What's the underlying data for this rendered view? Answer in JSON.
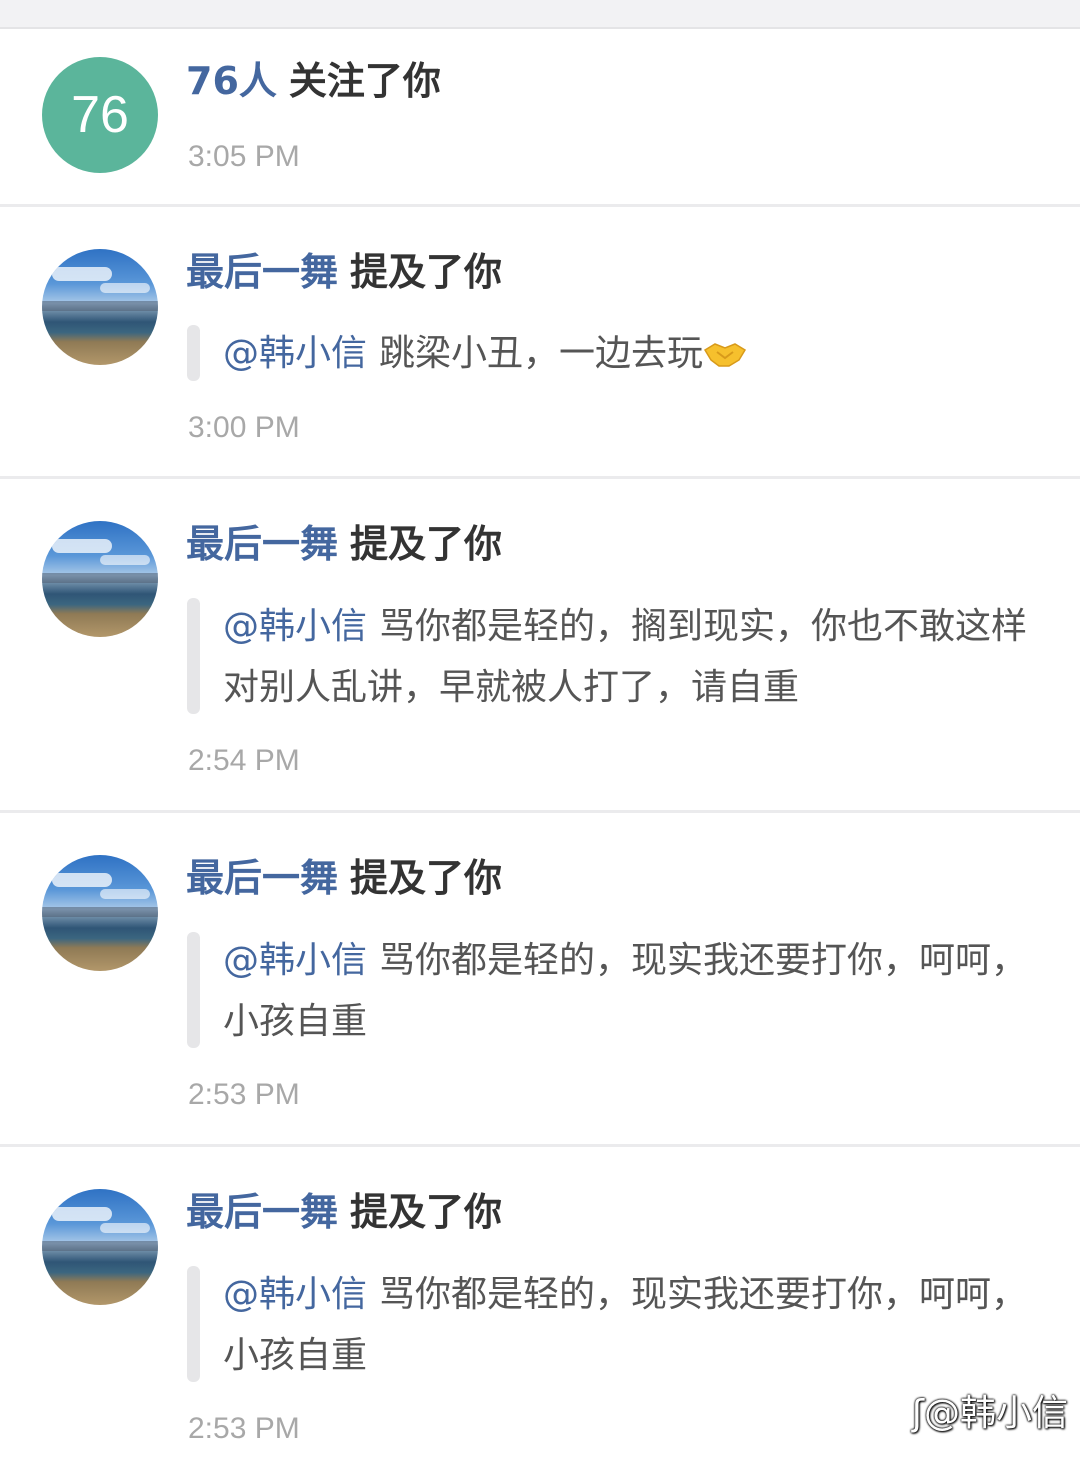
{
  "items": [
    {
      "avatar_text": "76",
      "name": "76人",
      "action": "关注了你",
      "time": "3:05 PM"
    },
    {
      "name": "最后一舞",
      "action": "提及了你",
      "mention": "@韩小信",
      "text": "跳梁小丑，一边去玩",
      "emoji": "handshake-emoji",
      "time": "3:00 PM"
    },
    {
      "name": "最后一舞",
      "action": "提及了你",
      "mention": "@韩小信",
      "text": "骂你都是轻的，搁到现实，你也不敢这样对别人乱讲，早就被人打了，请自重",
      "time": "2:54 PM"
    },
    {
      "name": "最后一舞",
      "action": "提及了你",
      "mention": "@韩小信",
      "text": "骂你都是轻的，现实我还要打你，呵呵，小孩自重",
      "time": "2:53 PM"
    },
    {
      "name": "最后一舞",
      "action": "提及了你",
      "mention": "@韩小信",
      "text": "骂你都是轻的，现实我还要打你，呵呵，小孩自重",
      "time": "2:53 PM"
    }
  ],
  "watermark": "@韩小信",
  "colors": {
    "name_blue": "#44679f",
    "count_avatar": "#5bb59b",
    "time_gray": "#a8a8a8"
  }
}
